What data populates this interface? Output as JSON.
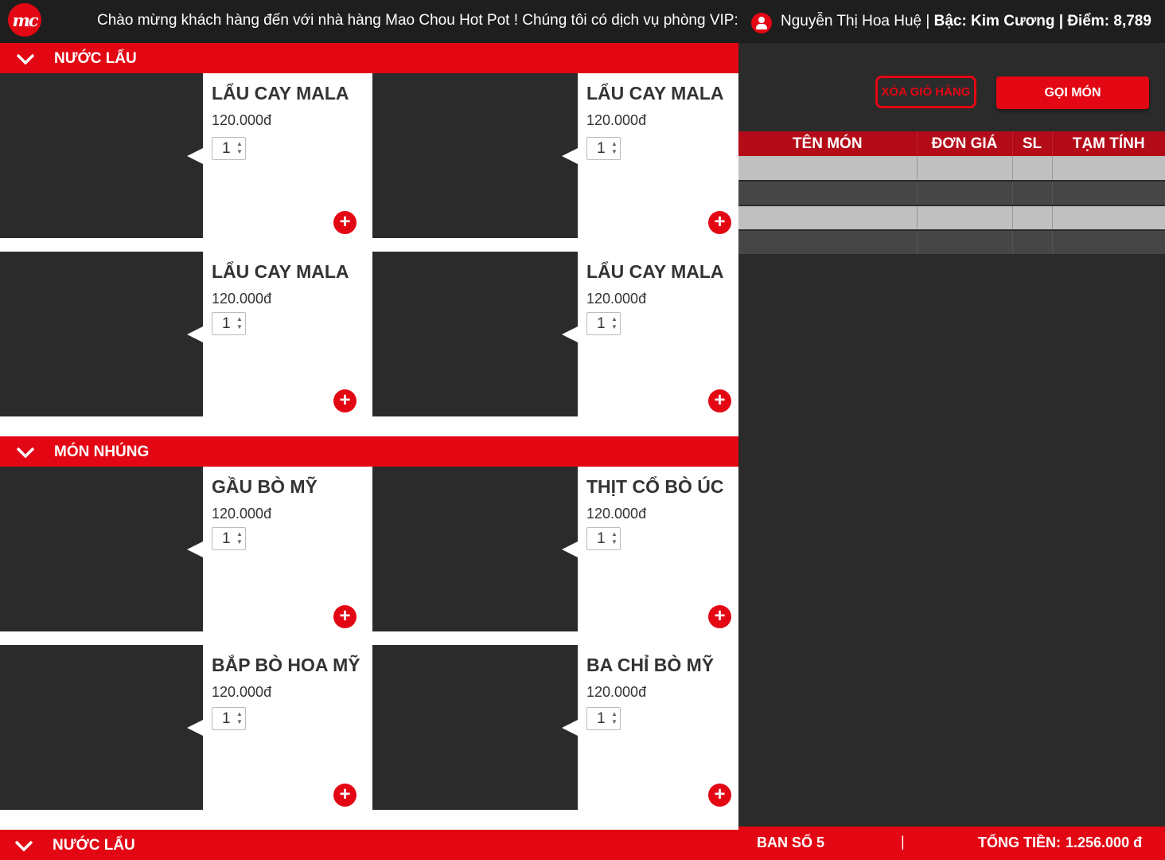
{
  "header": {
    "logo_text": "mc",
    "marquee": "Chào mừng khách hàng đến với nhà hàng Mao Chou Hot Pot ! Chúng tôi có dịch vụ phòng VIP: ...",
    "user_name": "Nguyễn Thị Hoa Huệ",
    "tier_label": "Bậc: Kim Cương",
    "points_label": "Điểm: 8,789"
  },
  "categories": [
    {
      "title": "NƯỚC LẨU",
      "items": [
        {
          "name": "LẨU CAY MALA",
          "price": "120.000đ",
          "qty": "1"
        },
        {
          "name": "LẨU CAY MALA",
          "price": "120.000đ",
          "qty": "1"
        },
        {
          "name": "LẨU CAY MALA",
          "price": "120.000đ",
          "qty": "1"
        },
        {
          "name": "LẨU CAY MALA",
          "price": "120.000đ",
          "qty": "1"
        }
      ]
    },
    {
      "title": "MÓN NHÚNG",
      "items": [
        {
          "name": "GẦU BÒ MỸ",
          "price": "120.000đ",
          "qty": "1"
        },
        {
          "name": "THỊT CỔ BÒ ÚC",
          "price": "120.000đ",
          "qty": "1"
        },
        {
          "name": "BẮP BÒ HOA MỸ",
          "price": "120.000đ",
          "qty": "1"
        },
        {
          "name": "BA CHỈ BÒ MỸ",
          "price": "120.000đ",
          "qty": "1"
        }
      ]
    },
    {
      "title": "NƯỚC LẨU",
      "items": []
    }
  ],
  "cart": {
    "clear_label": "XÓA GIỎ HÀNG",
    "order_label": "GỌI MÓN",
    "columns": [
      "TÊN MÓN",
      "ĐƠN GIÁ",
      "SL",
      "TẠM TÍNH"
    ],
    "rows": [
      [
        "",
        "",
        "",
        ""
      ],
      [
        "",
        "",
        "",
        ""
      ],
      [
        "",
        "",
        "",
        ""
      ],
      [
        "",
        "",
        "",
        ""
      ]
    ]
  },
  "footer": {
    "table_label": "BAN SỐ 5",
    "separator": "|",
    "total_label": "TỔNG TIỀN:",
    "total_value": "1.256.000 đ"
  },
  "colors": {
    "accent": "#e30613",
    "table_header": "#b30c18",
    "panel": "#2b2b2b",
    "topbar": "#1e1e1e"
  },
  "icons": {
    "collapse": "chevron-down-icon",
    "add": "plus-circle-icon",
    "user": "user-circle-icon"
  }
}
